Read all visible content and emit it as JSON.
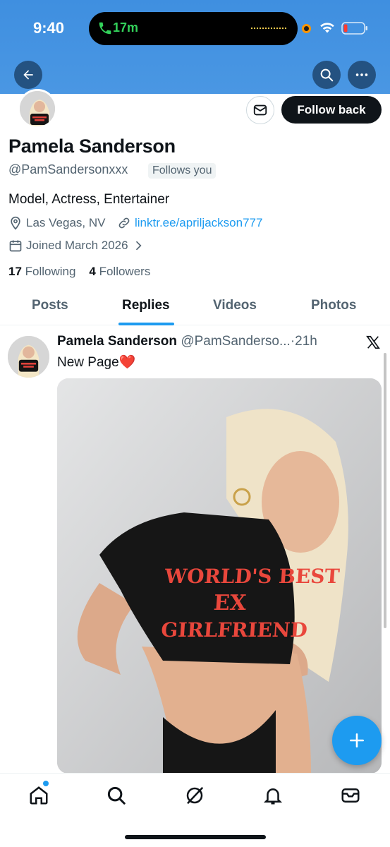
{
  "status_bar": {
    "time": "9:40",
    "call_duration": "17m"
  },
  "header": {
    "back_label": "Back",
    "search_label": "Search",
    "more_label": "More"
  },
  "profile": {
    "name": "Pamela Sanderson",
    "handle": "@PamSandersonxxx",
    "follows_you": "Follows you",
    "bio": "Model, Actress, Entertainer",
    "location": "Las Vegas, NV",
    "link": "linktr.ee/apriljackson777",
    "joined": "Joined March 2026",
    "following_count": "17",
    "following_label": "Following",
    "followers_count": "4",
    "followers_label": "Followers",
    "follow_back_label": "Follow back"
  },
  "tabs": [
    {
      "label": "Posts"
    },
    {
      "label": "Replies"
    },
    {
      "label": "Videos"
    },
    {
      "label": "Photos"
    }
  ],
  "active_tab": "Replies",
  "post": {
    "author": "Pamela Sanderson",
    "handle": "@PamSanderso...",
    "time": "21h",
    "text": "New Page",
    "emoji": "❤️",
    "image_shirt_text": [
      "WORLD'S BEST",
      "EX",
      "GIRLFRIEND"
    ]
  },
  "bottom_nav": [
    "home-icon",
    "search-icon",
    "grok-icon",
    "notifications-icon",
    "messages-icon"
  ],
  "colors": {
    "accent": "#1d9bf0",
    "banner": "#4a97e3",
    "text": "#0f1419",
    "muted": "#536471"
  }
}
